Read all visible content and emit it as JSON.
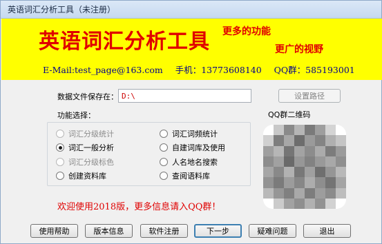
{
  "window": {
    "title": "英语词汇分析工具（未注册）"
  },
  "banner": {
    "main_title": "英语词汇分析工具",
    "slogan_line1": "更多的功能",
    "slogan_line2": "更广的视野",
    "email": "E-Mail:test_page@163.com",
    "phone": "手机：13773608140",
    "qq_group": "QQ群：585193001"
  },
  "save_path": {
    "label": "数据文件保存在：",
    "value": "D:\\",
    "set_button": "设置路径"
  },
  "function_select": {
    "label": "功能选择：",
    "options": [
      {
        "label": "词汇分级统计",
        "checked": false,
        "enabled": false
      },
      {
        "label": "词汇词频统计",
        "checked": false,
        "enabled": true
      },
      {
        "label": "词汇一般分析",
        "checked": true,
        "enabled": true
      },
      {
        "label": "自建词库及使用",
        "checked": false,
        "enabled": true
      },
      {
        "label": "词汇分级标色",
        "checked": false,
        "enabled": false
      },
      {
        "label": "人名地名搜索",
        "checked": false,
        "enabled": true
      },
      {
        "label": "创建资料库",
        "checked": false,
        "enabled": true
      },
      {
        "label": "查阅语料库",
        "checked": false,
        "enabled": true
      }
    ]
  },
  "qr": {
    "label": "QQ群二维码"
  },
  "welcome_text": "欢迎使用2018版，更多信息请入QQ群！",
  "buttons": {
    "help": "使用帮助",
    "version": "版本信息",
    "register": "软件注册",
    "next": "下一步",
    "faq": "疑难问题",
    "exit": "退出"
  },
  "colors": {
    "banner_bg": "#ffff00",
    "banner_text": "#e00000",
    "contact_text": "#00008b",
    "path_text": "#cc0000"
  }
}
